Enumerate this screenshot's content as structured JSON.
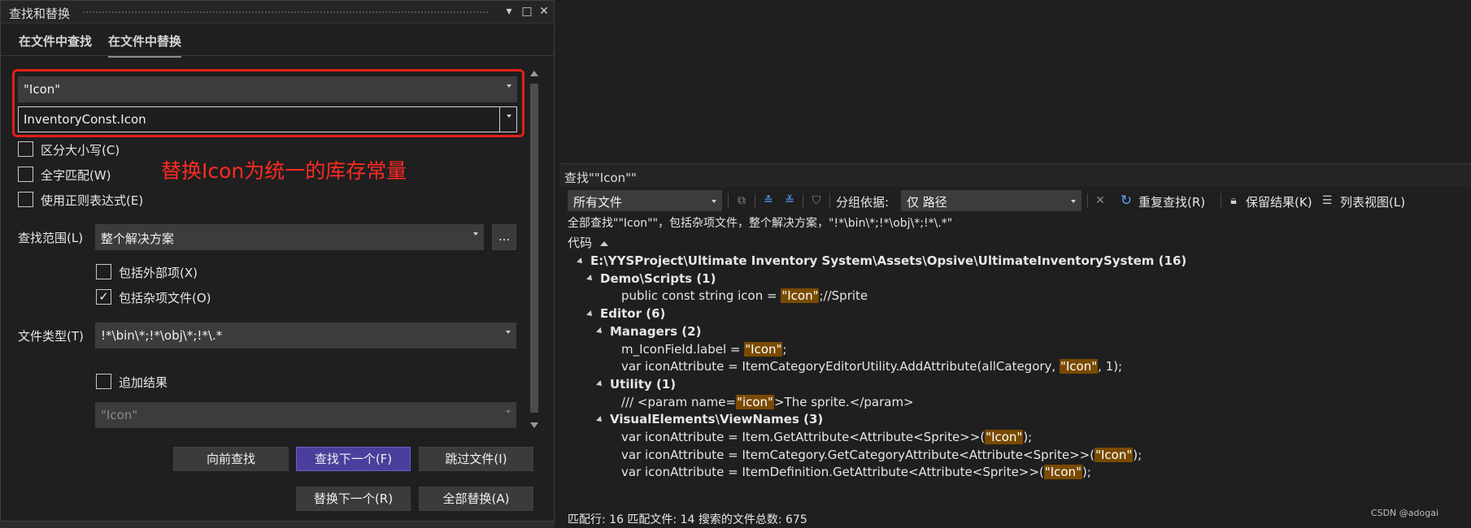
{
  "dialog": {
    "title": "查找和替换",
    "tabs": [
      "在文件中查找",
      "在文件中替换"
    ],
    "find_value": "\"Icon\"",
    "replace_value": "InventoryConst.Icon",
    "options": {
      "match_case": {
        "label": "区分大小写(C)",
        "checked": false
      },
      "whole_word": {
        "label": "全字匹配(W)",
        "checked": false
      },
      "regex": {
        "label": "使用正则表达式(E)",
        "checked": false
      }
    },
    "annotation": "替换Icon为统一的库存常量",
    "scope": {
      "label": "查找范围(L)",
      "value": "整个解决方案",
      "browse": "..."
    },
    "include_external": {
      "label": "包括外部项(X)",
      "checked": false
    },
    "include_misc": {
      "label": "包括杂项文件(O)",
      "checked": true,
      "mark": "✓"
    },
    "file_types": {
      "label": "文件类型(T)",
      "value": "!*\\bin\\*;!*\\obj\\*;!*\\.*"
    },
    "append_results": {
      "label": "追加结果",
      "checked": false
    },
    "disabled_combo": "\"Icon\"",
    "buttons": {
      "find_previous": "向前查找",
      "find_next": "查找下一个(F)",
      "skip_file": "跳过文件(I)",
      "replace_next": "替换下一个(R)",
      "replace_all": "全部替换(A)"
    },
    "title_buttons": {
      "dropdown": "▾",
      "restore": "□",
      "close": "✕"
    }
  },
  "results": {
    "title": "查找\"\"Icon\"\"",
    "toolbar": {
      "scope": "所有文件",
      "group_by_label": "分组依据:",
      "group_by_value": "仅 路径",
      "refind": "重复查找(R)",
      "keep_results": "保留结果(K)",
      "list_view": "列表视图(L)"
    },
    "summary": "全部查找\"\"Icon\"\"，包括杂项文件，整个解决方案，\"!*\\bin\\*;!*\\obj\\*;!*\\.*\"",
    "column_header": "代码",
    "tree": [
      {
        "depth": 0,
        "bold": true,
        "expander": true,
        "text": "E:\\YYSProject\\Ultimate Inventory System\\Assets\\Opsive\\UltimateInventorySystem (16)"
      },
      {
        "depth": 1,
        "bold": true,
        "expander": true,
        "text": "Demo\\Scripts (1)"
      },
      {
        "depth": 2,
        "bold": false,
        "expander": false,
        "pre": "public const string icon = ",
        "hl": "\"Icon\"",
        "post": ";//Sprite"
      },
      {
        "depth": 1,
        "bold": true,
        "expander": true,
        "text": "Editor (6)"
      },
      {
        "depth": 2,
        "bold": true,
        "expander": true,
        "text": "Managers (2)"
      },
      {
        "depth": 3,
        "bold": false,
        "expander": false,
        "pre": "m_IconField.label = ",
        "hl": "\"Icon\"",
        "post": ";"
      },
      {
        "depth": 3,
        "bold": false,
        "expander": false,
        "pre": "var iconAttribute = ItemCategoryEditorUtility.AddAttribute(allCategory, ",
        "hl": "\"Icon\"",
        "post": ", 1);"
      },
      {
        "depth": 2,
        "bold": true,
        "expander": true,
        "text": "Utility (1)"
      },
      {
        "depth": 3,
        "bold": false,
        "expander": false,
        "pre": "/// <param name=",
        "hl": "\"icon\"",
        "post": ">The sprite.</param>"
      },
      {
        "depth": 2,
        "bold": true,
        "expander": true,
        "text": "VisualElements\\ViewNames (3)"
      },
      {
        "depth": 3,
        "bold": false,
        "expander": false,
        "pre": "var iconAttribute = Item.GetAttribute<Attribute<Sprite>>(",
        "hl": "\"Icon\"",
        "post": ");"
      },
      {
        "depth": 3,
        "bold": false,
        "expander": false,
        "pre": "var iconAttribute = ItemCategory.GetCategoryAttribute<Attribute<Sprite>>(",
        "hl": "\"Icon\"",
        "post": ");"
      },
      {
        "depth": 3,
        "bold": false,
        "expander": false,
        "pre": "var iconAttribute = ItemDefinition.GetAttribute<Attribute<Sprite>>(",
        "hl": "\"Icon\"",
        "post": ");"
      }
    ],
    "status": "匹配行: 16 匹配文件: 14 搜索的文件总数: 675",
    "watermark": "CSDN @adogai"
  },
  "colors": {
    "accent": "#4a3f9c",
    "highlight": "#7a4a00",
    "annotation": "#ff2b22"
  }
}
